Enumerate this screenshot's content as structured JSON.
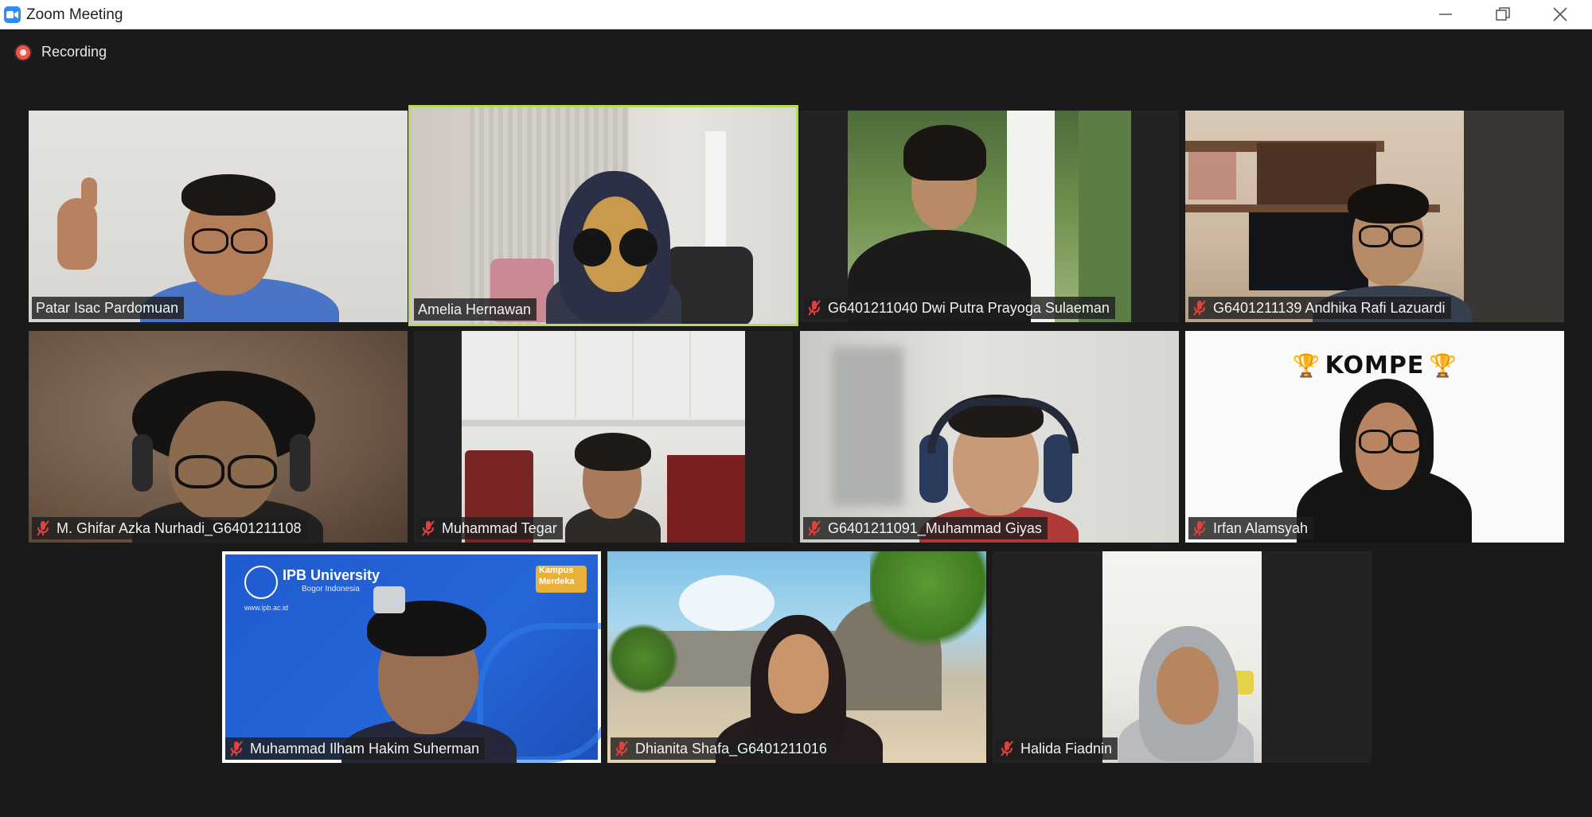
{
  "window": {
    "title": "Zoom Meeting",
    "controls": [
      "minimize",
      "restore",
      "close"
    ]
  },
  "recording": {
    "label": "Recording"
  },
  "participants": [
    {
      "name": "Patar Isac Pardomuan",
      "muted": false,
      "active": false
    },
    {
      "name": "Amelia Hernawan",
      "muted": false,
      "active": true
    },
    {
      "name": "G6401211040 Dwi Putra Prayoga Sulaeman",
      "muted": true,
      "active": false
    },
    {
      "name": "G6401211139 Andhika Rafi Lazuardi",
      "muted": true,
      "active": false
    },
    {
      "name": "M. Ghifar Azka Nurhadi_G6401211108",
      "muted": true,
      "active": false
    },
    {
      "name": "Muhammad Tegar",
      "muted": true,
      "active": false
    },
    {
      "name": "G6401211091_Muhammad Giyas",
      "muted": true,
      "active": false
    },
    {
      "name": "Irfan Alamsyah",
      "muted": true,
      "active": false,
      "background_text": "KOMPE"
    },
    {
      "name": "Muhammad Ilham Hakim Suherman",
      "muted": true,
      "active": false,
      "background_text": {
        "org": "IPB University",
        "sub": "Bogor Indonesia",
        "site": "www.ipb.ac.id",
        "badge_line1": "Kampus",
        "badge_line2": "Merdeka"
      }
    },
    {
      "name": "Dhianita Shafa_G6401211016",
      "muted": true,
      "active": false
    },
    {
      "name": "Halida Fiadnin",
      "muted": true,
      "active": false
    }
  ],
  "colors": {
    "active_border": "#b6dc57",
    "muted_icon": "#e0423b",
    "recording_dot": "#e8574a",
    "zoom_blue": "#2d8cff"
  }
}
